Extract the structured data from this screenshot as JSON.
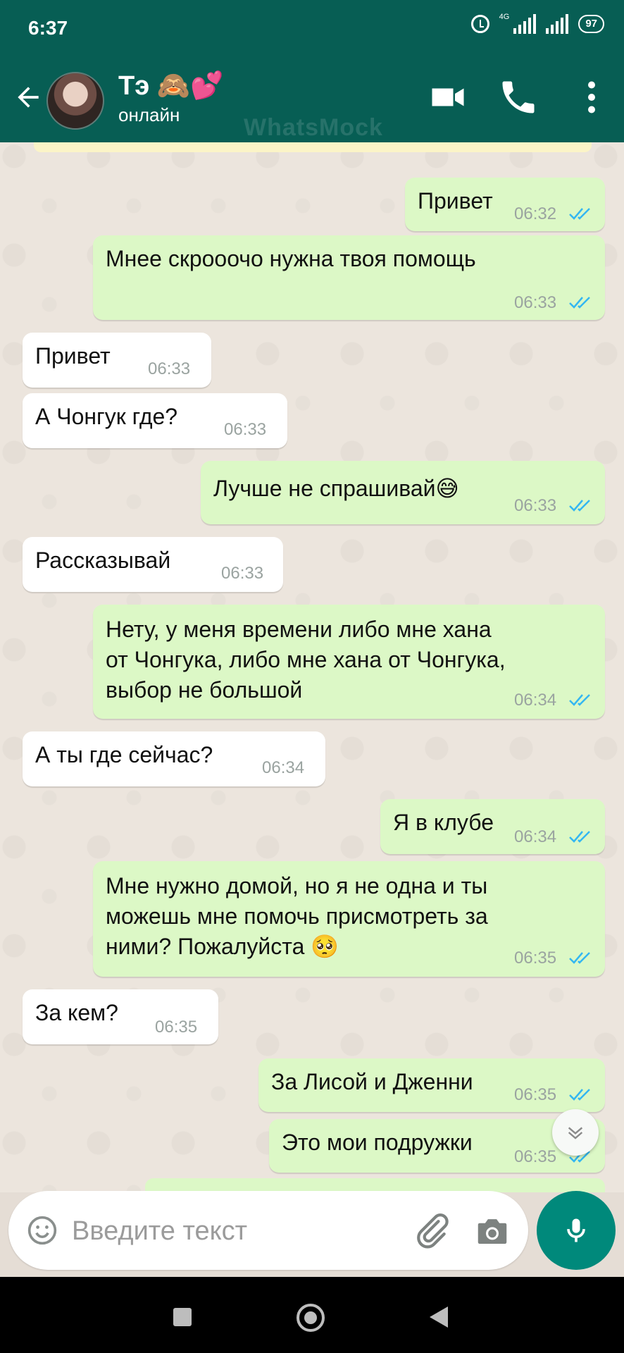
{
  "status_bar": {
    "time": "6:37",
    "network": "4G",
    "battery": "97"
  },
  "header": {
    "name": "Тэ 🙈💕",
    "status": "онлайн",
    "watermark": "WhatsMock"
  },
  "messages": [
    {
      "dir": "out",
      "text": "Привет",
      "time": "06:32",
      "read": true
    },
    {
      "dir": "out",
      "text": "Мнее скрооочо нужна твоя помощь",
      "time": "06:33",
      "read": true
    },
    {
      "dir": "in",
      "text": "Привет",
      "time": "06:33"
    },
    {
      "dir": "in",
      "text": "А Чонгук где?",
      "time": "06:33"
    },
    {
      "dir": "out",
      "text": "Лучше не спрашивай😅",
      "time": "06:33",
      "read": true
    },
    {
      "dir": "in",
      "text": "Рассказывай",
      "time": "06:33"
    },
    {
      "dir": "out",
      "text": "Нету, у меня времени либо мне хана\nот Чонгука, либо мне хана от Чонгука,\nвыбор не большой",
      "time": "06:34",
      "read": true
    },
    {
      "dir": "in",
      "text": "А ты где сейчас?",
      "time": "06:34"
    },
    {
      "dir": "out",
      "text": "Я в клубе",
      "time": "06:34",
      "read": true
    },
    {
      "dir": "out",
      "text": "Мне нужно домой, но я не одна и ты\nможешь мне помочь присмотреть за\nними? Пожалуйста 🥺",
      "time": "06:35",
      "read": true
    },
    {
      "dir": "in",
      "text": "За кем?",
      "time": "06:35"
    },
    {
      "dir": "out",
      "text": "За Лисой и Дженни",
      "time": "06:35",
      "read": true
    },
    {
      "dir": "out",
      "text": "Это мои подружки",
      "time": "06:35",
      "read": true
    }
  ],
  "composer": {
    "placeholder": "Введите текст"
  },
  "colors": {
    "header": "#075e54",
    "outgoing": "#dcf8c6",
    "incoming": "#ffffff",
    "tick": "#34b7f1",
    "fab": "#00897b"
  },
  "icons": [
    "back-arrow-icon",
    "video-call-icon",
    "phone-icon",
    "more-vert-icon",
    "emoji-icon",
    "attach-icon",
    "camera-icon",
    "mic-icon",
    "scroll-down-icon"
  ]
}
